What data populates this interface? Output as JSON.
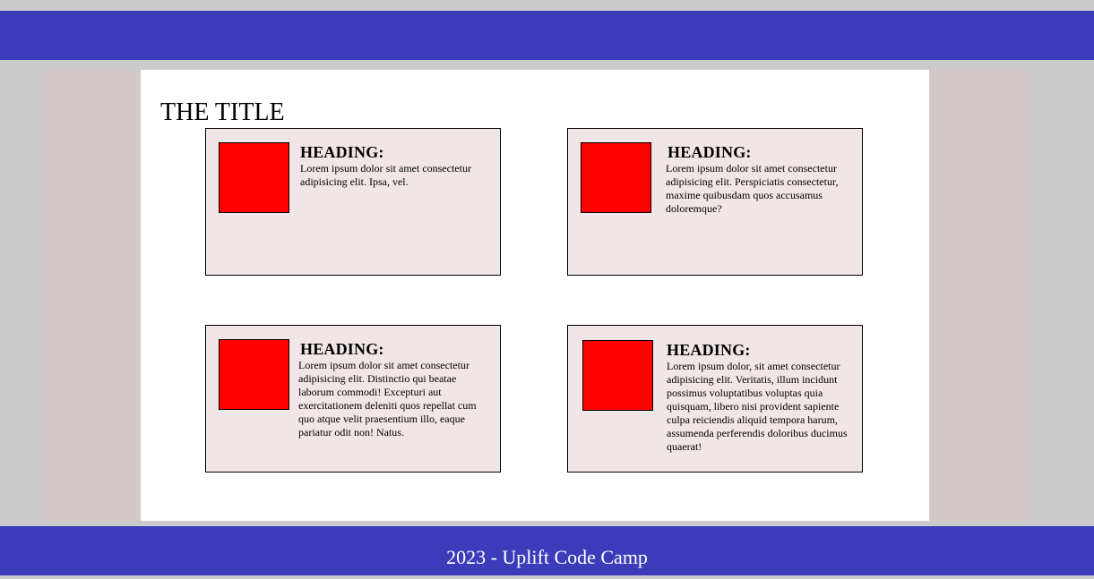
{
  "page": {
    "title": "THE TITLE",
    "footer_text": "2023 - Uplift Code Camp"
  },
  "cards": [
    {
      "heading": "HEADING:",
      "text": "Lorem ipsum dolor sit amet consectetur adipisicing elit. Ipsa, vel."
    },
    {
      "heading": "HEADING:",
      "text": "Lorem ipsum dolor sit amet consectetur adipisicing elit. Perspiciatis consectetur, maxime quibusdam quos accusamus doloremque?"
    },
    {
      "heading": "HEADING:",
      "text": "Lorem ipsum dolor sit amet consectetur adipisicing elit. Distinctio qui beatae laborum commodi! Excepturi aut exercitationem deleniti quos repellat cum quo atque velit praesentium illo, eaque pariatur odit non! Natus."
    },
    {
      "heading": "HEADING:",
      "text": "Lorem ipsum dolor, sit amet consectetur adipisicing elit. Veritatis, illum incidunt possimus voluptatibus voluptas quia quisquam, libero nisi provident sapiente culpa reiciendis aliquid tempora harum, assumenda perferendis doloribus ducimus quaerat!"
    }
  ],
  "colors": {
    "header_bar": "#3c3cbb",
    "footer_bar": "#3c3cbb",
    "page_background": "#cbcbcb",
    "side_panel": "#d4c9c9",
    "content_background": "#ffffff",
    "card_background": "#f0e6e6",
    "card_thumbnail": "#ff0000"
  }
}
